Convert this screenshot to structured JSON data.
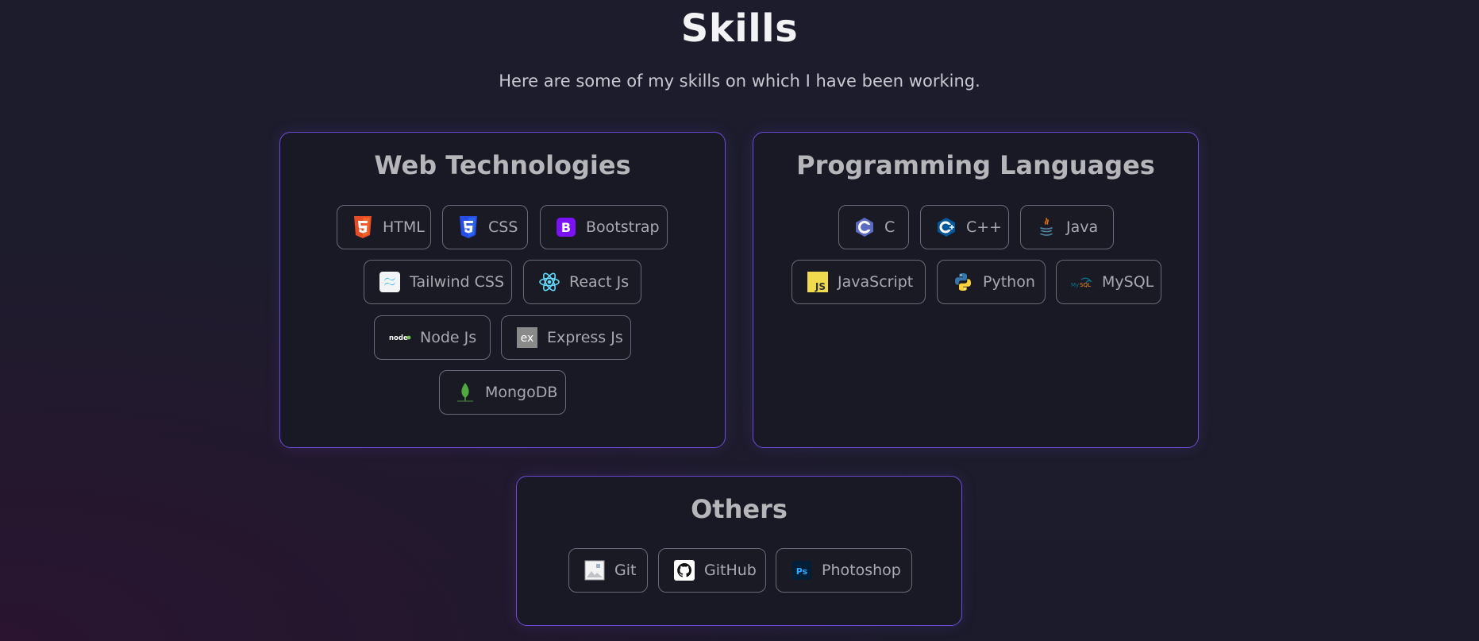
{
  "header": {
    "title": "Skills",
    "subtitle": "Here are some of my skills on which I have been working."
  },
  "groups": [
    {
      "title": "Web Technologies",
      "skills": [
        {
          "label": "HTML",
          "icon": "html5-icon"
        },
        {
          "label": "CSS",
          "icon": "css3-icon"
        },
        {
          "label": "Bootstrap",
          "icon": "bootstrap-icon"
        },
        {
          "label": "Tailwind CSS",
          "icon": "tailwind-icon"
        },
        {
          "label": "React Js",
          "icon": "react-icon"
        },
        {
          "label": "Node Js",
          "icon": "nodejs-icon"
        },
        {
          "label": "Express Js",
          "icon": "express-icon"
        },
        {
          "label": "MongoDB",
          "icon": "mongodb-icon"
        }
      ]
    },
    {
      "title": "Programming Languages",
      "skills": [
        {
          "label": "C",
          "icon": "c-icon"
        },
        {
          "label": "C++",
          "icon": "cpp-icon"
        },
        {
          "label": "Java",
          "icon": "java-icon"
        },
        {
          "label": "JavaScript",
          "icon": "javascript-icon"
        },
        {
          "label": "Python",
          "icon": "python-icon"
        },
        {
          "label": "MySQL",
          "icon": "mysql-icon"
        }
      ]
    },
    {
      "title": "Others",
      "skills": [
        {
          "label": "Git",
          "icon": "git-icon"
        },
        {
          "label": "GitHub",
          "icon": "github-icon"
        },
        {
          "label": "Photoshop",
          "icon": "photoshop-icon"
        }
      ]
    }
  ],
  "colors": {
    "accent_border": "#6d4bd4",
    "background": "#1c1c2c",
    "card_background": "#191925",
    "chip_border": "#6a6a78"
  }
}
